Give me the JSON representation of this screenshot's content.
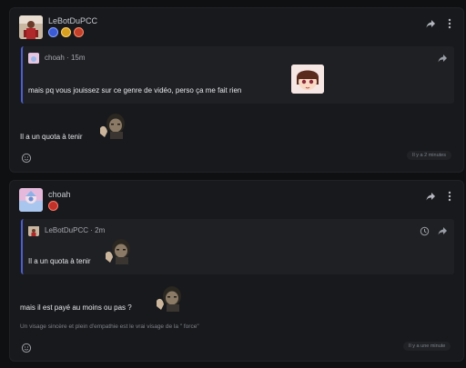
{
  "posts": [
    {
      "author": "LeBotDuPCC",
      "badges": [
        "blue-badge-icon",
        "gold-badge-icon",
        "red-badge-icon"
      ],
      "quote": {
        "author": "choah",
        "time": "15m",
        "text": "mais pq vous jouissez sur ce genre de vidéo, perso ça me fait rien"
      },
      "message": "Il a un quota à tenir",
      "timestamp": "Il y a 2 minutes"
    },
    {
      "author": "choah",
      "badges": [
        "red-badge-icon"
      ],
      "quote": {
        "author": "LeBotDuPCC",
        "time": "2m",
        "text": "Il a un quota à tenir"
      },
      "message": "mais il est payé au moins ou pas ?",
      "subtext": "Un visage sincère et plein d'empathie est le vrai visage de la \" force\"",
      "timestamp": "Il y a une minute"
    }
  ],
  "colors": {
    "background": "#0f1012",
    "card": "#18191c",
    "quote_bg": "#1f2024",
    "quote_border": "#4b5fd0"
  }
}
